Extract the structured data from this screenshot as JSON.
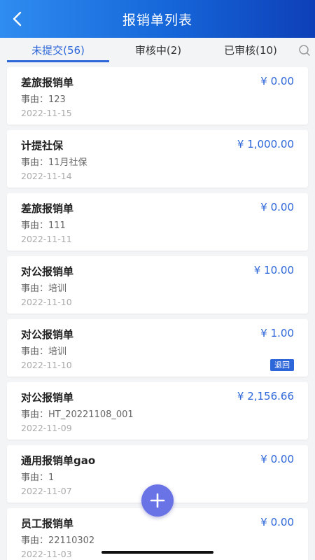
{
  "header": {
    "title": "报销单列表",
    "back_icon": "chevron-left-icon"
  },
  "tabs": [
    {
      "label": "未提交(56)",
      "active": true
    },
    {
      "label": "审核中(2)",
      "active": false
    },
    {
      "label": "已审核(10)",
      "active": false
    }
  ],
  "search_icon": "search-icon",
  "cards": [
    {
      "title": "差旅报销单",
      "amount": "¥ 0.00",
      "reason": "事由：123",
      "date": "2022-11-15"
    },
    {
      "title": "计提社保",
      "amount": "¥ 1,000.00",
      "reason": "事由：11月社保",
      "date": "2022-11-14"
    },
    {
      "title": "差旅报销单",
      "amount": "¥ 0.00",
      "reason": "事由：111",
      "date": "2022-11-11"
    },
    {
      "title": "对公报销单",
      "amount": "¥ 10.00",
      "reason": "事由：培训",
      "date": "2022-11-10"
    },
    {
      "title": "对公报销单",
      "amount": "¥ 1.00",
      "reason": "事由：培训",
      "date": "2022-11-10",
      "badge": "退回"
    },
    {
      "title": "对公报销单",
      "amount": "¥ 2,156.66",
      "reason": "事由：HT_20221108_001",
      "date": "2022-11-09"
    },
    {
      "title": "通用报销单gao",
      "amount": "¥ 0.00",
      "reason": "事由：1",
      "date": "2022-11-07"
    },
    {
      "title": "员工报销单",
      "amount": "¥ 0.00",
      "reason": "事由：22110302",
      "date": "2022-11-03"
    }
  ],
  "fab_icon": "plus-icon",
  "colors": {
    "accent": "#2c66d9",
    "header_start": "#2f8cf0",
    "header_end": "#0e3fb8",
    "fab": "#6a73e6"
  }
}
